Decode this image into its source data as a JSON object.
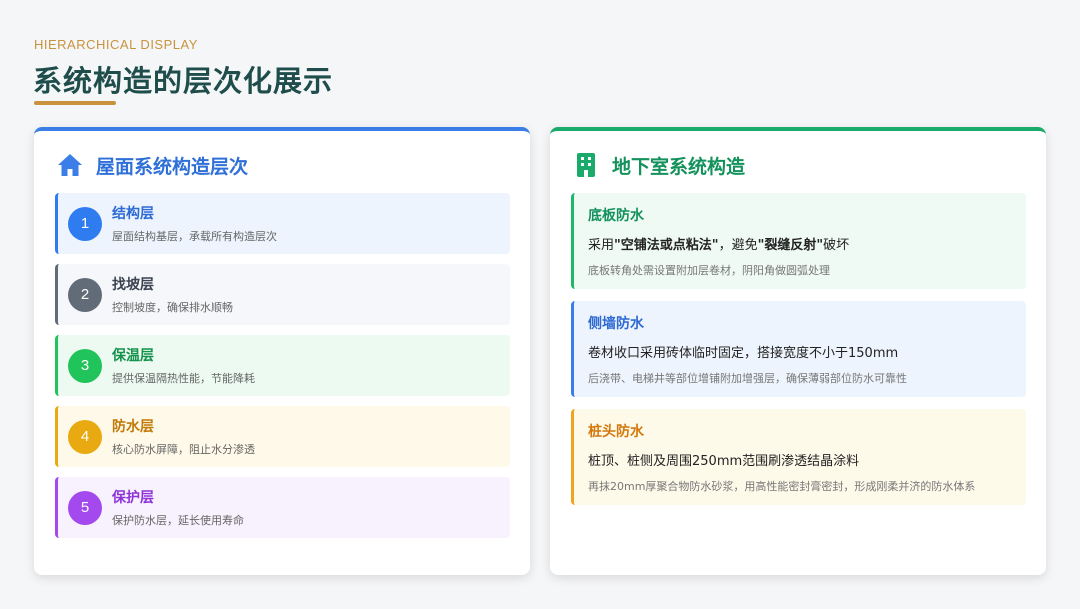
{
  "header": {
    "eyebrow": "HIERARCHICAL DISPLAY",
    "title": "系统构造的层次化展示"
  },
  "colors": {
    "accent_gold": "#c9933e",
    "title_green": "#1f4d4b",
    "blue": "#3b7ee8",
    "green": "#1aaa6a"
  },
  "roof": {
    "icon": "home-icon",
    "title": "屋面系统构造层次",
    "layers": [
      {
        "num": "1",
        "name": "结构层",
        "desc": "屋面结构基层，承载所有构造层次",
        "color": "#2f7cf0",
        "bg": "#edf4fe",
        "text_color": "#2e6ad3"
      },
      {
        "num": "2",
        "name": "找坡层",
        "desc": "控制坡度，确保排水顺畅",
        "color": "#626b78",
        "bg": "#f5f7fa",
        "text_color": "#3b4350"
      },
      {
        "num": "3",
        "name": "保温层",
        "desc": "提供保温隔热性能，节能降耗",
        "color": "#21c45a",
        "bg": "#edfaf2",
        "text_color": "#14924a"
      },
      {
        "num": "4",
        "name": "防水层",
        "desc": "核心防水屏障，阻止水分渗透",
        "color": "#e8aa10",
        "bg": "#fef9e8",
        "text_color": "#c27a08"
      },
      {
        "num": "5",
        "name": "保护层",
        "desc": "保护防水层，延长使用寿命",
        "color": "#a449ee",
        "bg": "#f8f1fe",
        "text_color": "#8f33d8"
      }
    ]
  },
  "basement": {
    "icon": "building-icon",
    "title": "地下室系统构造",
    "parts": [
      {
        "name": "底板防水",
        "main_pre": "采用",
        "main_bold1": "\"空铺法或点粘法\"",
        "main_mid": "，避免",
        "main_bold2": "\"裂缝反射\"",
        "main_post": "破坏",
        "note": "底板转角处需设置附加层卷材，阴阳角做圆弧处理",
        "color": "#1fb868",
        "bg": "#eefaf3",
        "text_color": "#14925c"
      },
      {
        "name": "侧墙防水",
        "main_pre": "卷材收口采用砖体临时固定，搭接宽度不小于150mm",
        "note": "后浇带、电梯井等部位增铺附加增强层，确保薄弱部位防水可靠性",
        "color": "#3b7ee8",
        "bg": "#eef4fd",
        "text_color": "#2e6ad3"
      },
      {
        "name": "桩头防水",
        "main_pre": "桩顶、桩侧及周围250mm范围刷渗透结晶涂料",
        "note": "再抹20mm厚聚合物防水砂浆，用高性能密封膏密封，形成刚柔并济的防水体系",
        "color": "#f0a31c",
        "bg": "#fefaea",
        "text_color": "#d4780c"
      }
    ]
  }
}
